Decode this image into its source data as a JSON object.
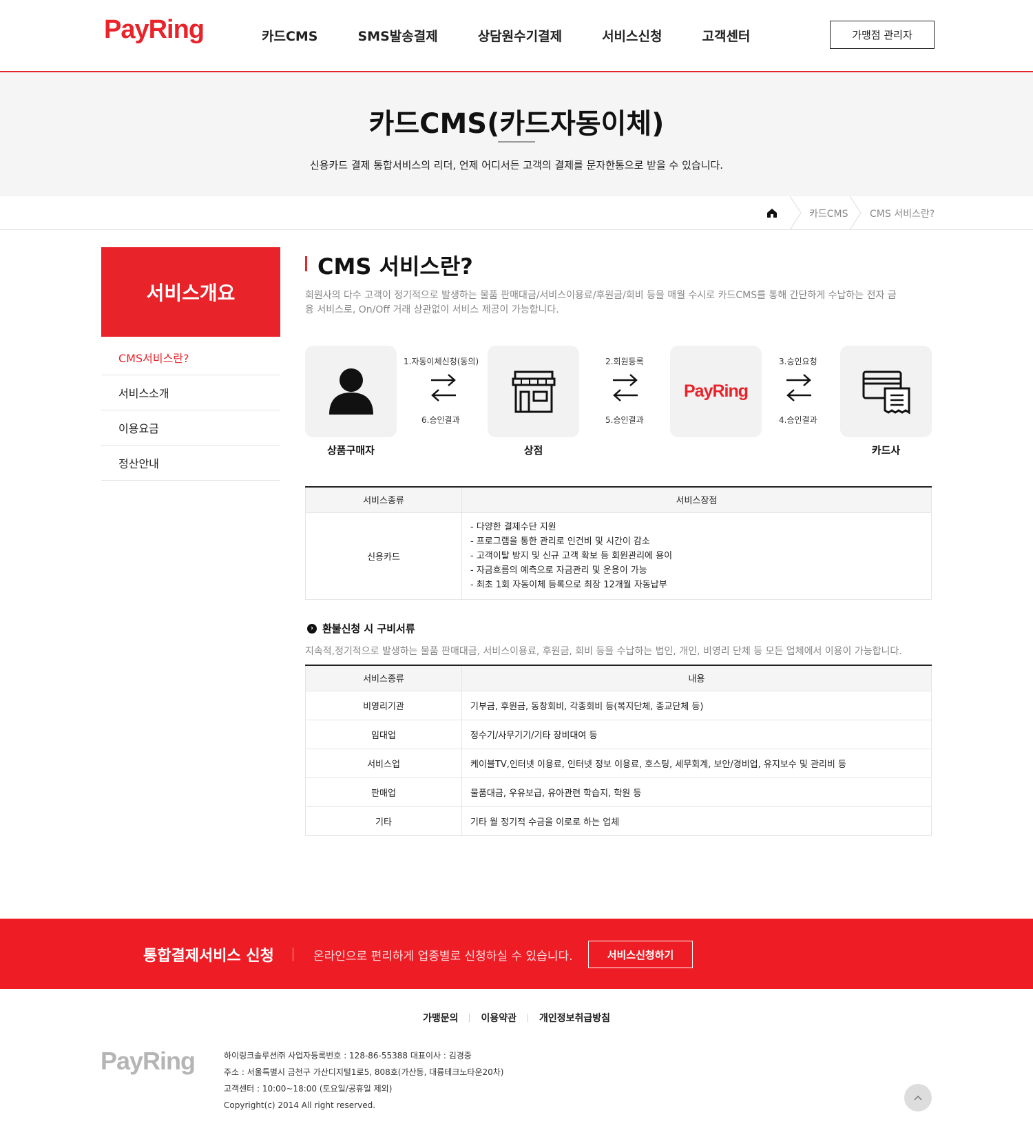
{
  "header": {
    "logo": "PayRing",
    "nav": [
      "카드CMS",
      "SMS발송결제",
      "상담원수기결제",
      "서비스신청",
      "고객센터"
    ],
    "admin_button": "가맹점 관리자"
  },
  "banner": {
    "title": "카드CMS(카드자동이체)",
    "description": "신용카드 결제 통합서비스의 리더, 언제 어디서든 고객의 결제를 문자한통으로 받을 수 있습니다."
  },
  "breadcrumb": [
    "카드CMS",
    "CMS 서비스란?"
  ],
  "sidebar": {
    "title": "서비스개요",
    "items": [
      "CMS서비스란?",
      "서비스소개",
      "이용요금",
      "정산안내"
    ]
  },
  "main": {
    "title": "CMS 서비스란?",
    "description": "회원사의 다수 고객이 정기적으로 발생하는 물품 판매대금/서비스이용료/후원금/회비 등을 매월 수시로 카드CMS를 통해 간단하게 수납하는 전자 금융 서비스로, On/Off 거래 상관없이 서비스 제공이 가능합니다.",
    "flow": {
      "buyer": "상품구매자",
      "store": "상점",
      "payring": "PayRing",
      "card": "카드사",
      "step1": "1.자동이체신청(동의)",
      "step6": "6.승인결과",
      "step2": "2.회원등록",
      "step5": "5.승인결과",
      "step3": "3.승인요청",
      "step4": "4.승인결과"
    },
    "table1": {
      "headers": [
        "서비스종류",
        "서비스장점"
      ],
      "kind": "신용카드",
      "points": [
        "- 다양한 결제수단 지원",
        "- 프로그램을 통한 관리로 인건비 및 시간이 감소",
        "- 고객이탈 방지 및 신규 고객 확보 등 회원관리에 용이",
        "- 자금흐름의 예측으로 자금관리 및 운용이 가능",
        "- 최초 1회 자동이체 등록으로 최장 12개월 자동납부"
      ]
    },
    "refund": {
      "title": "환불신청 시 구비서류",
      "description": "지속적,정기적으로 발생하는 물품 판매대금, 서비스이용료, 후원금, 회비 등을 수납하는 법인, 개인, 비영리 단체 등 모든 업체에서 이용이 가능합니다."
    },
    "table2": {
      "headers": [
        "서비스종류",
        "내용"
      ],
      "rows": [
        {
          "kind": "비영리기관",
          "detail": "기부금, 후원금, 동창회비, 각종회비 등(복지단체, 종교단체 등)"
        },
        {
          "kind": "임대업",
          "detail": "정수기/사무기기/기타 장비대여 등"
        },
        {
          "kind": "서비스업",
          "detail": "케이블TV,인터넷 이용료, 인터넷 정보 이용료, 호스팅, 세무회계, 보안/경비업, 유지보수 및 관리비 등"
        },
        {
          "kind": "판매업",
          "detail": "물품대금, 우유보급, 유아관련 학습지, 학원 등"
        },
        {
          "kind": "기타",
          "detail": "기타 월 정기적 수금을 이로로 하는 업체"
        }
      ]
    }
  },
  "band": {
    "title": "통합결제서비스 신청",
    "description": "온라인으로 편리하게 업종별로 신청하실 수 있습니다.",
    "button": "서비스신청하기"
  },
  "footer": {
    "links": [
      "가맹문의",
      "이용약관",
      "개인정보취급방침"
    ],
    "logo": "PayRing",
    "info": [
      "하이링크솔루션㈜ 사업자등록번호 : 128-86-55388 대표이사 : 김경중",
      "주소 : 서울특별시 금천구 가산디지털1로5, 808호(가산동, 대륭테크노타운20차)",
      "고객센터 : 10:00~18:00 (토요일/공휴일 제외)",
      "Copyright(c) 2014 All right reserved."
    ]
  },
  "colors": {
    "accent": "#e8232a",
    "band": "#ee1c25"
  }
}
